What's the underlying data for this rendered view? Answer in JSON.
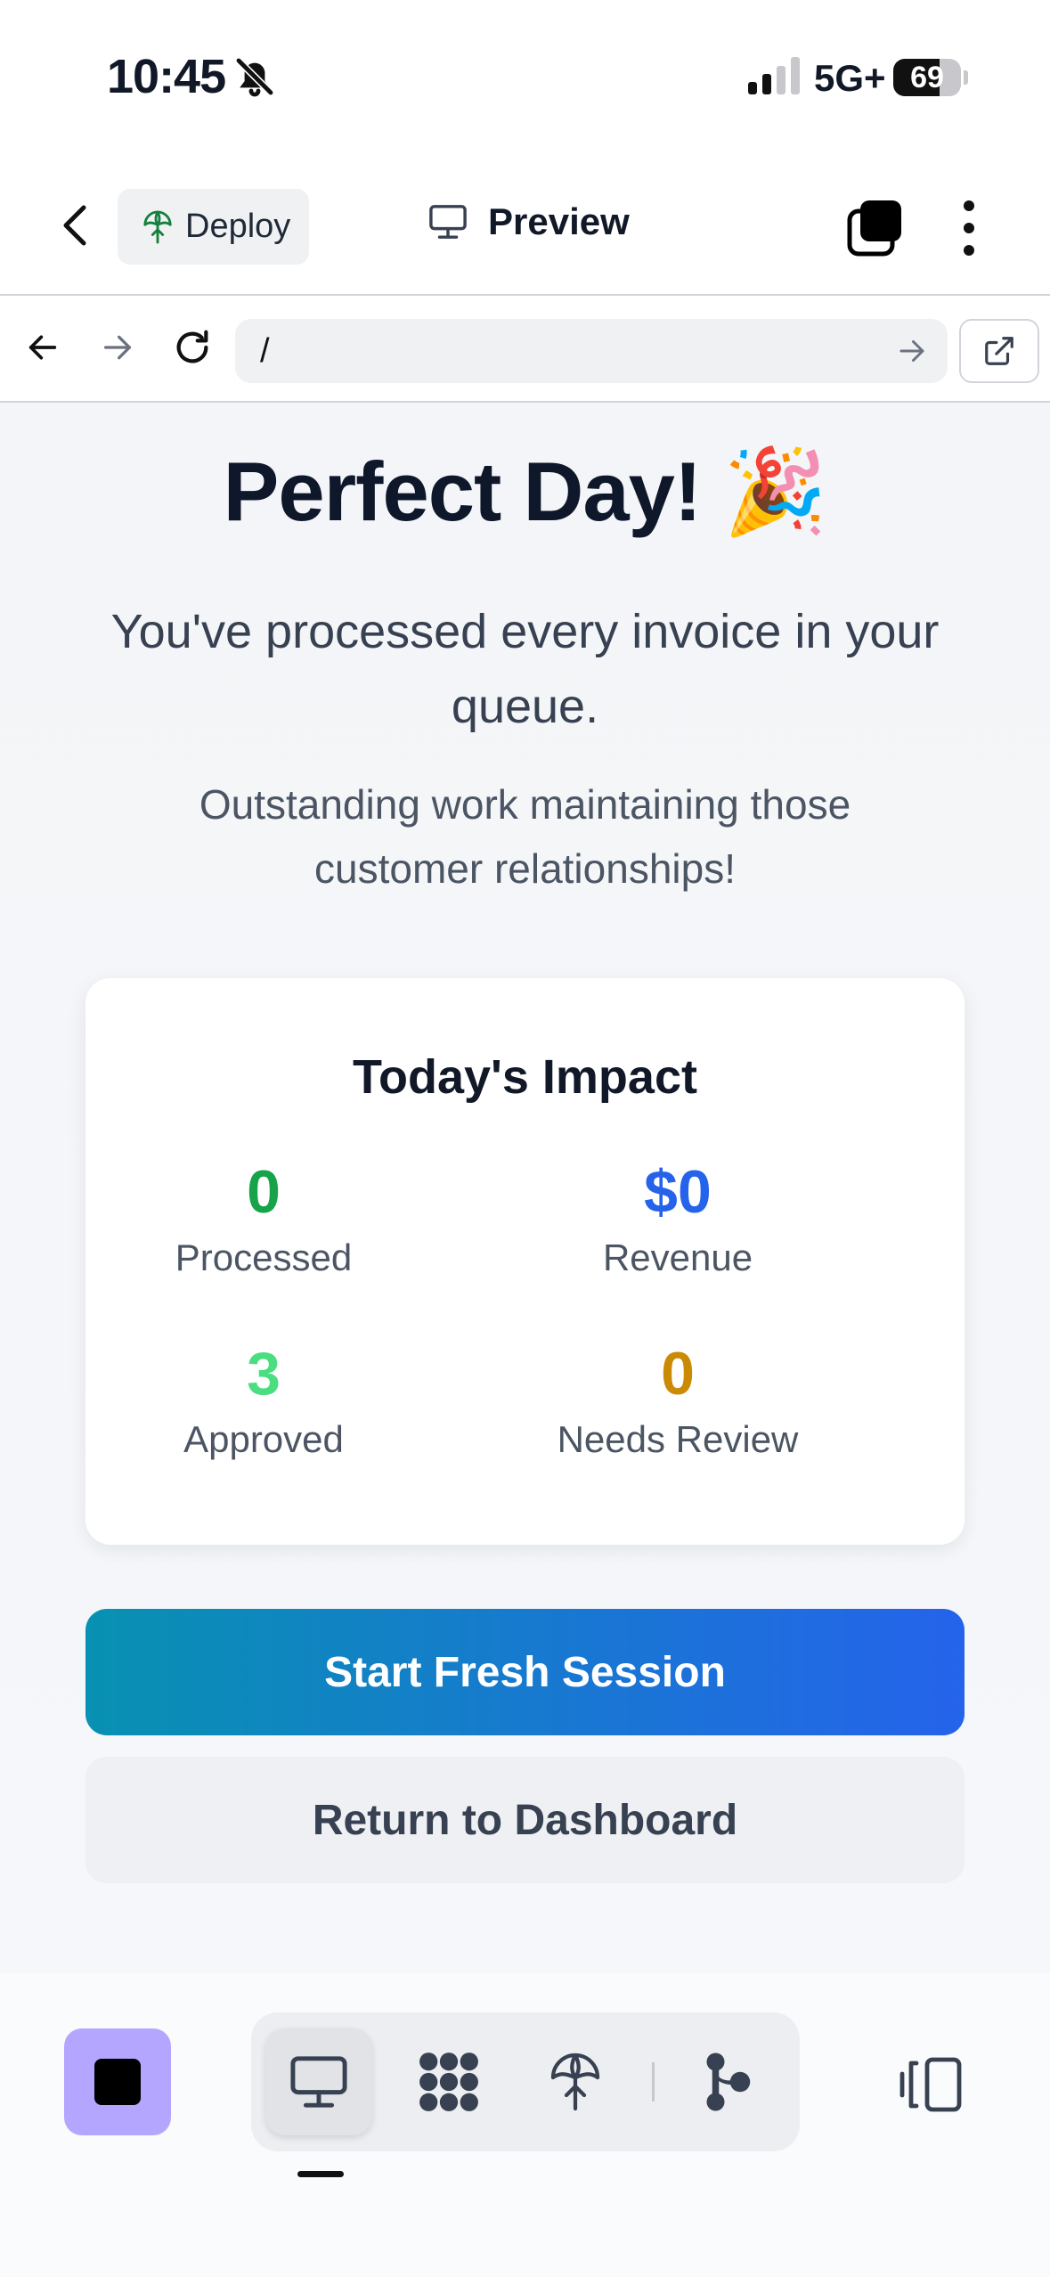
{
  "status_bar": {
    "time": "10:45",
    "network": "5G+",
    "battery_level": 69,
    "battery_text": "69"
  },
  "toolbar": {
    "deploy_label": "Deploy",
    "preview_label": "Preview"
  },
  "browser": {
    "url": "/"
  },
  "main": {
    "title": "Perfect Day! 🎉",
    "subtitle": "You've processed every invoice in your queue.",
    "message": "Outstanding work maintaining those customer relationships!",
    "impact": {
      "title": "Today's Impact",
      "stats": [
        {
          "value": "0",
          "label": "Processed",
          "color": "#16a34a"
        },
        {
          "value": "$0",
          "label": "Revenue",
          "color": "#2563eb"
        },
        {
          "value": "3",
          "label": "Approved",
          "color": "#4ade80"
        },
        {
          "value": "0",
          "label": "Needs Review",
          "color": "#ca8a04"
        }
      ]
    },
    "primary_button": "Start Fresh Session",
    "secondary_button": "Return to Dashboard"
  },
  "bottom_bar": {
    "stop_color": "#b4a6ff",
    "tools": [
      "monitor-icon",
      "apps-icon",
      "deploy-icon",
      "git-branch-icon"
    ],
    "active_tool": "monitor-icon"
  }
}
